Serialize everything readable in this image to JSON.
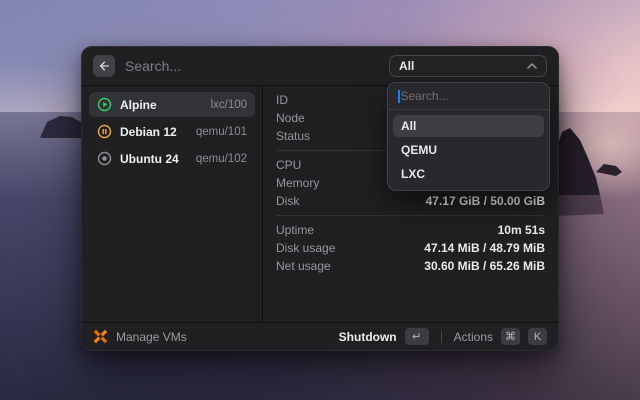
{
  "topbar": {
    "search_placeholder": "Search...",
    "filter_value": "All"
  },
  "vms": [
    {
      "name": "Alpine",
      "vmid": "lxc/100",
      "status": "running",
      "icon": "play-circle-icon",
      "selected": true
    },
    {
      "name": "Debian 12",
      "vmid": "qemu/101",
      "status": "paused",
      "icon": "pause-circle-icon",
      "selected": false
    },
    {
      "name": "Ubuntu 24",
      "vmid": "qemu/102",
      "status": "stopped",
      "icon": "stop-circle-icon",
      "selected": false
    }
  ],
  "details": {
    "rows": [
      {
        "label": "ID",
        "value": ""
      },
      {
        "label": "Node",
        "value": ""
      },
      {
        "label": "Status",
        "value": ""
      },
      {
        "label": "CPU",
        "value": ""
      },
      {
        "label": "Memory",
        "value": ""
      },
      {
        "label": "Disk",
        "value": "47.17 GiB / 50.00 GiB"
      },
      {
        "label": "Uptime",
        "value": "10m 51s"
      },
      {
        "label": "Disk usage",
        "value": "47.14 MiB / 48.79 MiB"
      },
      {
        "label": "Net usage",
        "value": "30.60 MiB / 65.26 MiB"
      }
    ]
  },
  "dropdown": {
    "search_placeholder": "Search...",
    "options": [
      {
        "label": "All",
        "selected": true
      },
      {
        "label": "QEMU",
        "selected": false
      },
      {
        "label": "LXC",
        "selected": false
      }
    ]
  },
  "footer": {
    "brand_label": "Manage VMs",
    "shutdown_label": "Shutdown",
    "return_key": "↵",
    "actions_label": "Actions",
    "cmd_key": "⌘",
    "k_key": "K"
  },
  "colors": {
    "window_bg": "#202023",
    "accent_orange": "#e57000",
    "running_green": "#2fd164",
    "paused_amber": "#e9a33d",
    "stopped_gray": "#8e8e93",
    "caret_blue": "#0a84ff"
  }
}
